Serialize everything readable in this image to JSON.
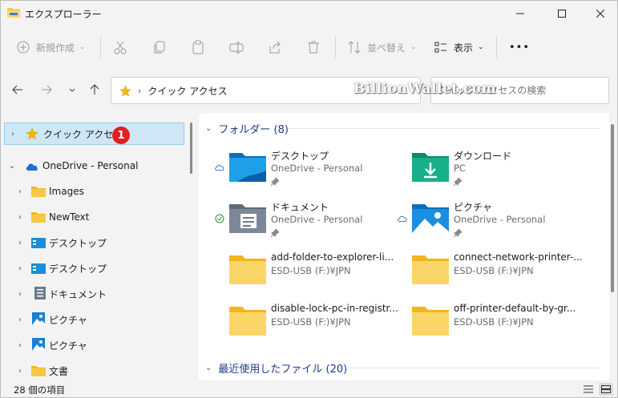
{
  "window": {
    "title": "エクスプローラー"
  },
  "toolbar": {
    "new_label": "新規作成",
    "sort_label": "並べ替え",
    "view_label": "表示",
    "more_label": "•••"
  },
  "address": {
    "crumb": "クイック アクセス",
    "search_placeholder": "クイック アクセスの検索",
    "watermark": "BillionWallet.com"
  },
  "navpane": {
    "badge": "1",
    "items": [
      {
        "label": "クイック アクセス"
      },
      {
        "label": "OneDrive - Personal"
      },
      {
        "label": "Images"
      },
      {
        "label": "NewText"
      },
      {
        "label": "デスクトップ"
      },
      {
        "label": "デスクトップ"
      },
      {
        "label": "ドキュメント"
      },
      {
        "label": "ピクチャ"
      },
      {
        "label": "ピクチャ"
      },
      {
        "label": "文書"
      }
    ]
  },
  "content": {
    "folders_header": "フォルダー (8)",
    "recent_header": "最近使用したファイル (20)",
    "tiles": [
      {
        "name": "デスクトップ",
        "location": "OneDrive - Personal"
      },
      {
        "name": "ダウンロード",
        "location": "PC"
      },
      {
        "name": "ドキュメント",
        "location": "OneDrive - Personal"
      },
      {
        "name": "ピクチャ",
        "location": "OneDrive - Personal"
      },
      {
        "name": "add-folder-to-explorer-li...",
        "location": "ESD-USB (F:)¥JPN"
      },
      {
        "name": "connect-network-printer-...",
        "location": "ESD-USB (F:)¥JPN"
      },
      {
        "name": "disable-lock-pc-in-registr...",
        "location": "ESD-USB (F:)¥JPN"
      },
      {
        "name": "off-printer-default-by-gr...",
        "location": "ESD-USB (F:)¥JPN"
      }
    ]
  },
  "status": {
    "item_count": "28 個の項目"
  },
  "colors": {
    "accent": "#0067c0",
    "selection": "#cfe6f7",
    "folder": "#f7c844",
    "badge": "#e41f1f"
  }
}
